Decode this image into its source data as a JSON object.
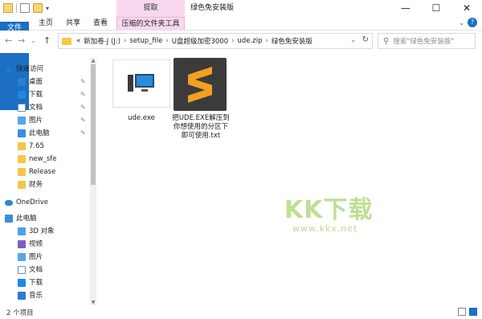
{
  "window": {
    "context_tab": "提取",
    "title": "绿色免安装版",
    "minimize": "—",
    "maximize": "☐",
    "close": "✕"
  },
  "ribbon": {
    "tabs": [
      "文件",
      "主页",
      "共享",
      "查看"
    ],
    "context_tab": "压缩的文件夹工具",
    "help": "?"
  },
  "address": {
    "prefix": "«",
    "crumbs": [
      "新加卷-J (J:)",
      "setup_file",
      "U盘超级加密3000",
      "ude.zip",
      "绿色免安装版"
    ],
    "separator": "›"
  },
  "search": {
    "placeholder": "搜索\"绿色免安装版\""
  },
  "sidebar": {
    "items": [
      {
        "label": "快速访问",
        "icon": "star-icon",
        "pinned": false
      },
      {
        "label": "桌面",
        "icon": "desktop-icon",
        "pinned": true
      },
      {
        "label": "下载",
        "icon": "download-icon",
        "pinned": true
      },
      {
        "label": "文档",
        "icon": "document-icon",
        "pinned": true
      },
      {
        "label": "图片",
        "icon": "picture-icon",
        "pinned": true
      },
      {
        "label": "此电脑",
        "icon": "computer-icon",
        "pinned": true
      },
      {
        "label": "7.65",
        "icon": "folder-icon",
        "pinned": false
      },
      {
        "label": "new_sfe",
        "icon": "folder-icon",
        "pinned": false
      },
      {
        "label": "Release",
        "icon": "folder-icon",
        "pinned": false
      },
      {
        "label": "财务",
        "icon": "folder-icon",
        "pinned": false
      },
      {
        "label": "OneDrive",
        "icon": "cloud-icon",
        "pinned": false
      },
      {
        "label": "此电脑",
        "icon": "computer-icon",
        "pinned": false
      },
      {
        "label": "3D 对象",
        "icon": "3d-objects-icon",
        "pinned": false
      },
      {
        "label": "视频",
        "icon": "video-icon",
        "pinned": false
      },
      {
        "label": "图片",
        "icon": "picture-icon",
        "pinned": false
      },
      {
        "label": "文档",
        "icon": "document-icon",
        "pinned": false
      },
      {
        "label": "下载",
        "icon": "download-icon",
        "pinned": false
      },
      {
        "label": "音乐",
        "icon": "music-icon",
        "pinned": false
      }
    ],
    "pin_glyph": "📌"
  },
  "files": [
    {
      "name": "ude.exe",
      "icon": "exe-icon"
    },
    {
      "name": "把UDE.EXE解压到你想使用的分区下即可使用.txt",
      "icon": "sublime-text-icon"
    }
  ],
  "watermark": {
    "big": "KK下载",
    "small": "www.kkx.net"
  },
  "status": {
    "count": "2 个项目"
  },
  "colors": {
    "accent": "#1c6fc2",
    "context_tab": "#f8d8ee",
    "folder": "#f4c64b",
    "watermark": "#8cc63f"
  }
}
